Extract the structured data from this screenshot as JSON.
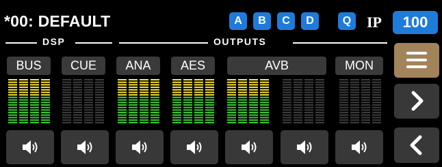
{
  "header": {
    "preset_title": "*00: DEFAULT",
    "banks": [
      "A",
      "B",
      "C",
      "D"
    ],
    "q_label": "Q",
    "ip_label": "IP",
    "ip_value": "100"
  },
  "groups": {
    "dsp": "DSP",
    "outputs": "OUTPUTS"
  },
  "channels": [
    {
      "label": "BUS",
      "active": true
    },
    {
      "label": "CUE",
      "active": false
    },
    {
      "label": "ANA",
      "active": true
    },
    {
      "label": "AES",
      "active": true
    },
    {
      "label": "AVB",
      "active": true
    },
    {
      "label": "",
      "active": false
    },
    {
      "label": "MON",
      "active": false
    }
  ],
  "mute_icon": "speaker-icon",
  "sidebar": {
    "menu_icon": "hamburger-menu-icon",
    "next_icon": "chevron-right-icon",
    "prev_icon": "chevron-left-icon"
  },
  "colors": {
    "accent_blue": "#1e7bd9",
    "menu_button": "#a3845a",
    "meter_yellow": "#ffe83a",
    "meter_green": "#39d12f",
    "meter_inactive": "#3e3e3e",
    "button_gray": "#383838"
  }
}
